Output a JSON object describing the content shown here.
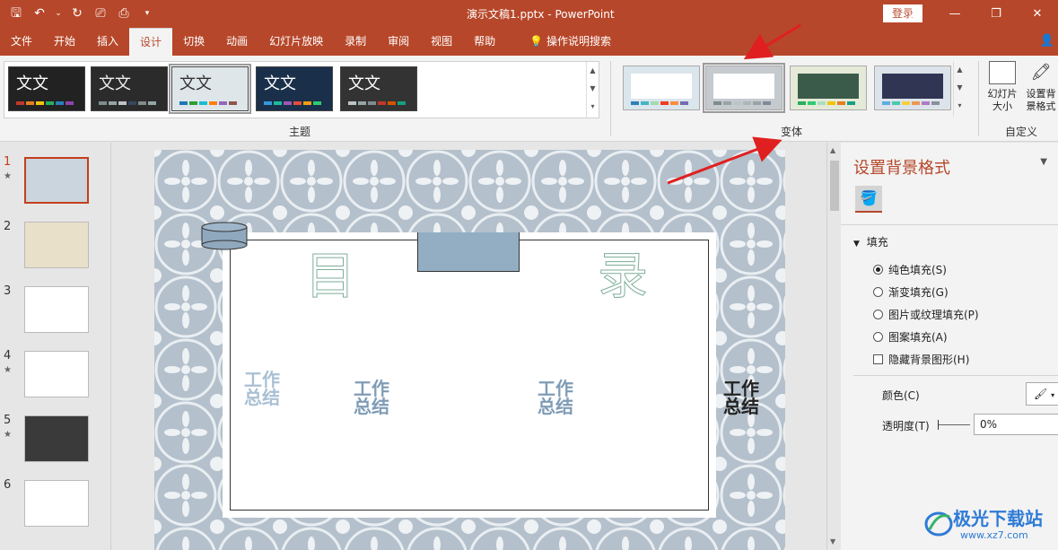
{
  "window": {
    "title": "演示文稿1.pptx  -  PowerPoint",
    "login_label": "登录"
  },
  "ribbon_tabs": [
    "文件",
    "开始",
    "插入",
    "设计",
    "切换",
    "动画",
    "幻灯片放映",
    "录制",
    "审阅",
    "视图",
    "帮助"
  ],
  "active_tab": "设计",
  "tell_me": "操作说明搜索",
  "themes_group": {
    "label": "主题",
    "items": [
      {
        "text": "文文",
        "bg": "#222222",
        "fg": "#ffffff",
        "bars": [
          "#c0392b",
          "#e67e22",
          "#f1c40f",
          "#27ae60",
          "#2980b9",
          "#8e44ad"
        ]
      },
      {
        "text": "文文",
        "bg": "#2b2b2b",
        "fg": "#eeeeee",
        "bars": [
          "#7f8c8d",
          "#95a5a6",
          "#bdc3c7",
          "#34495e",
          "#7f8c8d",
          "#95a5a6"
        ]
      },
      {
        "text": "文文",
        "bg": "#dfe6ea",
        "fg": "#333333",
        "bars": [
          "#1f77b4",
          "#2ca02c",
          "#17becf",
          "#ff7f0e",
          "#9467bd",
          "#8c564b"
        ]
      },
      {
        "text": "文文",
        "bg": "#1a2f4a",
        "fg": "#ffffff",
        "bars": [
          "#3498db",
          "#1abc9c",
          "#9b59b6",
          "#e74c3c",
          "#f39c12",
          "#2ecc71"
        ]
      },
      {
        "text": "文文",
        "bg": "#333333",
        "fg": "#ffffff",
        "bars": [
          "#bdc3c7",
          "#95a5a6",
          "#7f8c8d",
          "#c0392b",
          "#d35400",
          "#16a085"
        ]
      }
    ],
    "selected_index": 2
  },
  "variants_group": {
    "label": "变体",
    "items": [
      {
        "bg": "#dbe5ec",
        "inner": "#ffffff",
        "bars": [
          "#2c7fb8",
          "#41b6c4",
          "#a1dab4",
          "#f03b20",
          "#fd8d3c",
          "#756bb1"
        ]
      },
      {
        "bg": "#c5cacf",
        "inner": "#ffffff",
        "bars": [
          "#7f8c8d",
          "#95a5a6",
          "#bdc3c7",
          "#aab7b8",
          "#99a3a4",
          "#808b96"
        ]
      },
      {
        "bg": "#e4ead7",
        "inner": "#3b5b4a",
        "bars": [
          "#27ae60",
          "#2ecc71",
          "#a9dfbf",
          "#f1c40f",
          "#e67e22",
          "#16a085"
        ]
      },
      {
        "bg": "#dde3ea",
        "inner": "#2f3553",
        "bars": [
          "#5dade2",
          "#48c9b0",
          "#f4d03f",
          "#eb984e",
          "#af7ac5",
          "#85929e"
        ]
      }
    ],
    "selected_index": 1
  },
  "customize_group": {
    "label": "自定义",
    "slide_size": "幻灯片大小",
    "format_bg": "设置背景格式"
  },
  "slides": [
    {
      "num": "1",
      "star": true,
      "active": true
    },
    {
      "num": "2",
      "star": false,
      "active": false
    },
    {
      "num": "3",
      "star": false,
      "active": false
    },
    {
      "num": "4",
      "star": true,
      "active": false
    },
    {
      "num": "5",
      "star": true,
      "active": false
    },
    {
      "num": "6",
      "star": false,
      "active": false
    }
  ],
  "slide_content": {
    "title_left": "目",
    "title_right": "录",
    "items": [
      "工作\n总结",
      "工作\n总结",
      "工作\n总结",
      "工作\n总结"
    ]
  },
  "format_pane": {
    "title": "设置背景格式",
    "section": "填充",
    "options": [
      "纯色填充(S)",
      "渐变填充(G)",
      "图片或纹理填充(P)",
      "图案填充(A)"
    ],
    "selected_option": 0,
    "hide_bg": "隐藏背景图形(H)",
    "color_label": "颜色(C)",
    "transparency_label": "透明度(T)",
    "transparency_value": "0%"
  },
  "watermark": {
    "name": "极光下载站",
    "url": "www.xz7.com"
  }
}
